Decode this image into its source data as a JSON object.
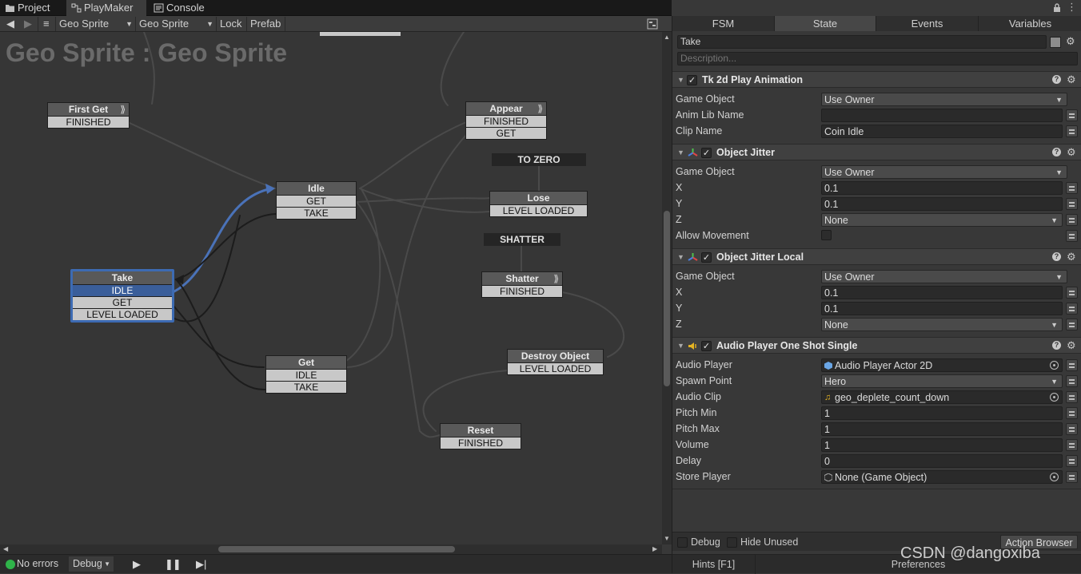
{
  "tabs": {
    "project": "Project",
    "playmaker": "PlayMaker",
    "console": "Console"
  },
  "toolbar": {
    "game_object": "Geo Sprite",
    "fsm": "Geo Sprite",
    "lock": "Lock",
    "prefab": "Prefab"
  },
  "graph": {
    "title": "Geo Sprite : Geo Sprite",
    "nodes": {
      "first_get": {
        "title": "First Get",
        "transitions": [
          "FINISHED"
        ]
      },
      "appear": {
        "title": "Appear",
        "transitions": [
          "FINISHED",
          "GET"
        ]
      },
      "idle": {
        "title": "Idle",
        "transitions": [
          "GET",
          "TAKE"
        ]
      },
      "lose": {
        "title": "Lose",
        "transitions": [
          "LEVEL LOADED"
        ]
      },
      "take": {
        "title": "Take",
        "transitions": [
          "IDLE",
          "GET",
          "LEVEL LOADED"
        ]
      },
      "shatter": {
        "title": "Shatter",
        "transitions": [
          "FINISHED"
        ]
      },
      "get": {
        "title": "Get",
        "transitions": [
          "IDLE",
          "TAKE"
        ]
      },
      "destroy_object": {
        "title": "Destroy Object",
        "transitions": [
          "LEVEL LOADED"
        ]
      },
      "reset": {
        "title": "Reset",
        "transitions": [
          "FINISHED"
        ]
      }
    },
    "global_events": {
      "to_zero": "TO ZERO",
      "shatter": "SHATTER"
    }
  },
  "status": {
    "errors": "No errors",
    "debug": "Debug"
  },
  "inspector": {
    "tabs": [
      "FSM",
      "State",
      "Events",
      "Variables"
    ],
    "active_tab": "State",
    "state_name": "Take",
    "description_placeholder": "Description...",
    "actions": [
      {
        "title": "Tk 2d Play Animation",
        "fields": [
          {
            "label": "Game Object",
            "value": "Use Owner"
          },
          {
            "label": "Anim Lib Name",
            "value": ""
          },
          {
            "label": "Clip Name",
            "value": "Coin Idle"
          }
        ]
      },
      {
        "title": "Object Jitter",
        "fields": [
          {
            "label": "Game Object",
            "value": "Use Owner"
          },
          {
            "label": "X",
            "value": "0.1"
          },
          {
            "label": "Y",
            "value": "0.1"
          },
          {
            "label": "Z",
            "value": "None"
          },
          {
            "label": "Allow Movement",
            "value": ""
          }
        ]
      },
      {
        "title": "Object Jitter Local",
        "fields": [
          {
            "label": "Game Object",
            "value": "Use Owner"
          },
          {
            "label": "X",
            "value": "0.1"
          },
          {
            "label": "Y",
            "value": "0.1"
          },
          {
            "label": "Z",
            "value": "None"
          }
        ]
      },
      {
        "title": "Audio Player One Shot Single",
        "fields": [
          {
            "label": "Audio Player",
            "value": "Audio Player Actor 2D"
          },
          {
            "label": "Spawn Point",
            "value": "Hero"
          },
          {
            "label": "Audio Clip",
            "value": "geo_deplete_count_down"
          },
          {
            "label": "Pitch Min",
            "value": "1"
          },
          {
            "label": "Pitch Max",
            "value": "1"
          },
          {
            "label": "Volume",
            "value": "1"
          },
          {
            "label": "Delay",
            "value": "0"
          },
          {
            "label": "Store Player",
            "value": "None (Game Object)"
          }
        ]
      }
    ],
    "footer": {
      "debug": "Debug",
      "hide_unused": "Hide Unused",
      "action_browser": "Action Browser",
      "hints": "Hints [F1]",
      "preferences": "Preferences"
    }
  },
  "watermark": "CSDN @dangoxiba",
  "colors": {
    "selection": "#3d6bb3",
    "canvas": "#363636",
    "panel": "#383838"
  }
}
